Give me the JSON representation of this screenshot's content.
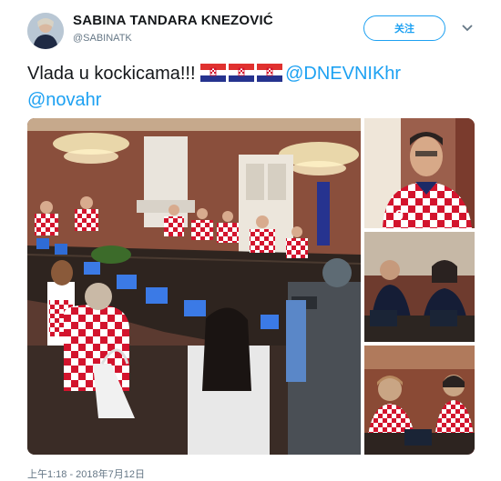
{
  "user": {
    "name": "SABINA TANDARA KNEZOVIĆ",
    "handle": "@SABINATK"
  },
  "follow_label": "关注",
  "tweet": {
    "text": "Vlada u kockicama!!!",
    "flag_icons": [
      "croatia-flag-icon",
      "croatia-flag-icon",
      "croatia-flag-icon"
    ],
    "mention_1": "@DNEVNIKhr",
    "mention_2": "@novahr"
  },
  "timestamp": "上午1:18 - 2018年7月12日",
  "colors": {
    "link": "#1da1f2",
    "checker_red": "#d3142d",
    "text_secondary": "#657786"
  }
}
